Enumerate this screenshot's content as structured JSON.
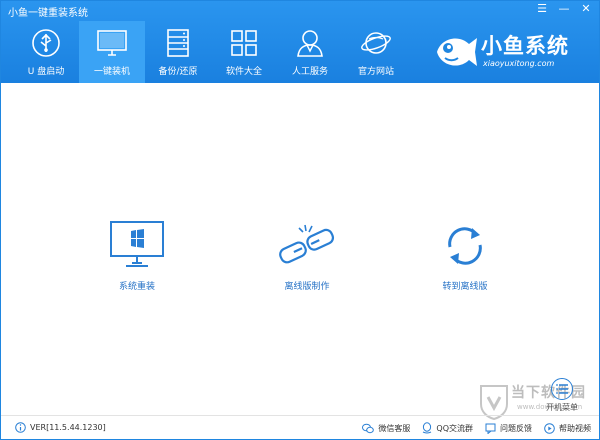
{
  "window": {
    "title": "小鱼一键重装系统",
    "controls": [
      "☰",
      "—",
      "✕"
    ]
  },
  "nav": {
    "items": [
      {
        "label": "U 盘启动",
        "icon": "usb-icon",
        "active": false
      },
      {
        "label": "一键装机",
        "icon": "monitor-icon",
        "active": true
      },
      {
        "label": "备份/还原",
        "icon": "server-icon",
        "active": false
      },
      {
        "label": "软件大全",
        "icon": "grid-apps-icon",
        "active": false
      },
      {
        "label": "人工服务",
        "icon": "user-service-icon",
        "active": false
      },
      {
        "label": "官方网站",
        "icon": "planet-icon",
        "active": false
      }
    ]
  },
  "logo": {
    "name": "小鱼系统",
    "url": "xiaoyuxitong.com"
  },
  "features": [
    {
      "label": "系统重装",
      "icon": "windows-monitor-icon"
    },
    {
      "label": "离线版制作",
      "icon": "chain-link-icon"
    },
    {
      "label": "转到离线版",
      "icon": "refresh-icon"
    }
  ],
  "boot_menu": {
    "label": "开机菜单"
  },
  "footer": {
    "version": "VER[11.5.44.1230]",
    "links": [
      {
        "label": "微信客服",
        "icon": "wechat-icon"
      },
      {
        "label": "QQ交流群",
        "icon": "qq-icon"
      },
      {
        "label": "问题反馈",
        "icon": "feedback-icon"
      },
      {
        "label": "帮助视频",
        "icon": "help-video-icon"
      }
    ]
  },
  "watermark": {
    "text": "当下软件园",
    "sub": "www.downxia.com"
  },
  "colors": {
    "header": "#1f86e0",
    "active_tab": "#3aa3f5",
    "icon_blue": "#2a7fd4"
  }
}
